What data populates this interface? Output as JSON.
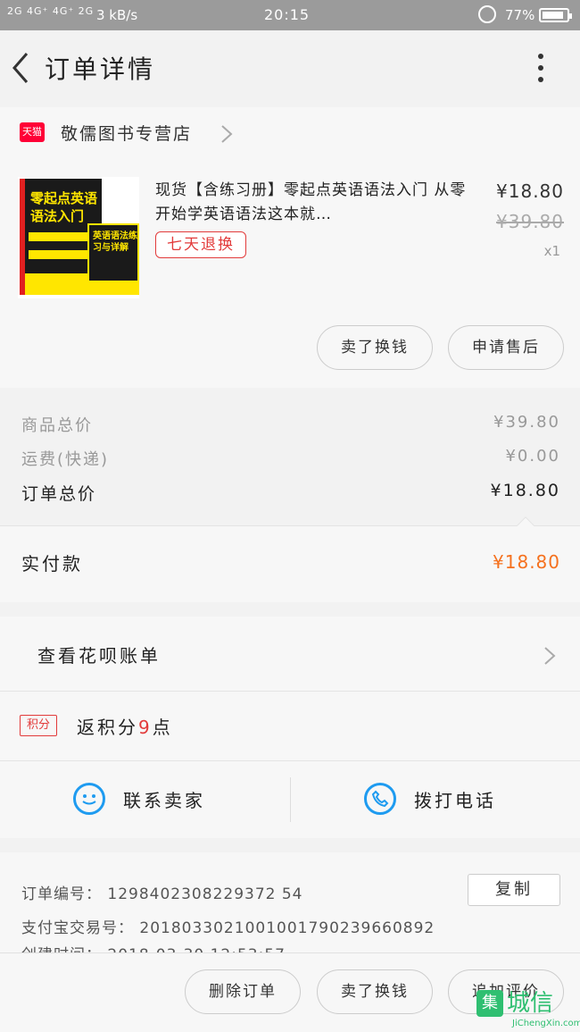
{
  "status_bar": {
    "signal": "2G 4G⁺ 4G⁺ 2G",
    "speed": "3 kB/s",
    "time": "20:15",
    "battery": "77%"
  },
  "header": {
    "title": "订单详情"
  },
  "store": {
    "badge": "天猫",
    "name": "敬儒图书专营店"
  },
  "product": {
    "cover_title_1": "零起点英语语法入门",
    "cover_title_2": "英语语法练习与详解",
    "title": "现货【含练习册】零起点英语语法入门 从零开始学英语语法这本就…",
    "badge": "七天退换",
    "price": "¥18.80",
    "original_price": "¥39.80",
    "quantity": "x1",
    "btn_exchange": "卖了换钱",
    "btn_after_sale": "申请售后"
  },
  "summary": {
    "goods_total_label": "商品总价",
    "goods_total_value": "¥39.80",
    "shipping_label": "运费(快递)",
    "shipping_value": "¥0.00",
    "order_total_label": "订单总价",
    "order_total_value": "¥18.80",
    "paid_label": "实付款",
    "paid_value": "¥18.80"
  },
  "huabei": {
    "label": "查看花呗账单"
  },
  "points": {
    "tag": "积分",
    "prefix": "返积分",
    "count": "9",
    "suffix": "点"
  },
  "contact": {
    "seller": "联系卖家",
    "phone": "拨打电话"
  },
  "order_info": {
    "order_no": "订单编号：  1298402308229372 54",
    "alipay_no": "支付宝交易号：  2018033021001001790239660892",
    "created": "创建时间：  2018-03-30 12:53:57",
    "copy": "复制"
  },
  "bottom_bar": {
    "delete": "删除订单",
    "exchange": "卖了换钱",
    "review": "追加评价"
  },
  "watermark": {
    "mark": "集",
    "text": "城信",
    "url": "JiChengXin.com"
  },
  "colors": {
    "accent_orange": "#f5711e",
    "red": "#e23b3b",
    "blue": "#1e9bf0",
    "tmall_red": "#ff0036"
  }
}
